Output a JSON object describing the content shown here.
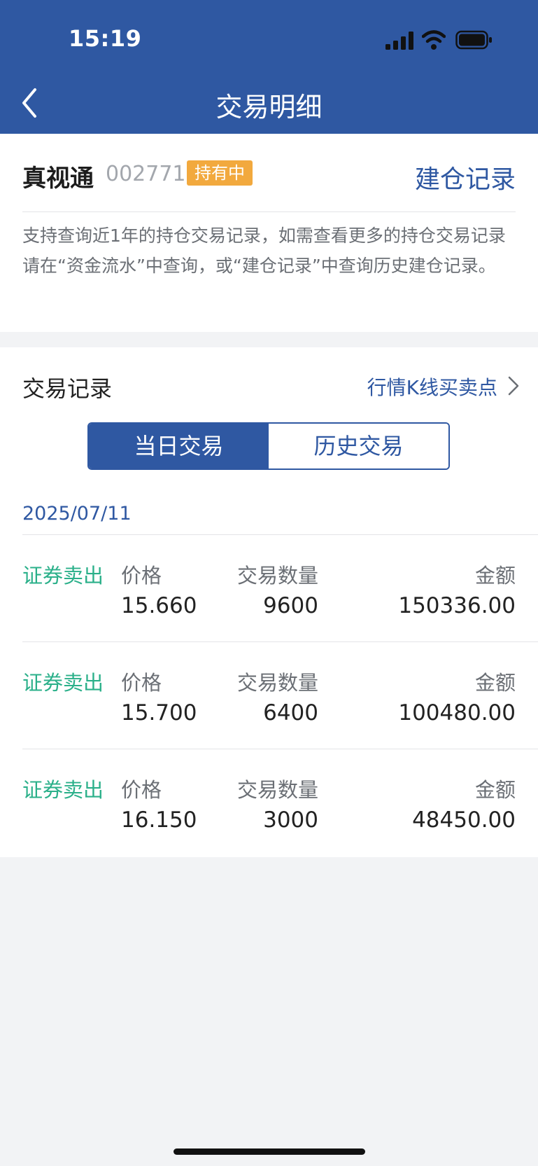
{
  "status_bar": {
    "time": "15:19"
  },
  "nav": {
    "title": "交易明细"
  },
  "stock": {
    "name": "真视通",
    "code": "002771",
    "badge": "持有中",
    "build_record_link": "建仓记录",
    "notice": "支持查询近1年的持仓交易记录，如需查看更多的持仓交易记录请在“资金流水”中查询，或“建仓记录”中查询历史建仓记录。"
  },
  "records": {
    "title": "交易记录",
    "kline_link": "行情K线买卖点",
    "tabs": [
      "当日交易",
      "历史交易"
    ],
    "active_tab": 0,
    "date": "2025/07/11",
    "labels": {
      "price": "价格",
      "quantity": "交易数量",
      "amount": "金额"
    },
    "trades": [
      {
        "type": "证券卖出",
        "price": "15.660",
        "quantity": "9600",
        "amount": "150336.00"
      },
      {
        "type": "证券卖出",
        "price": "15.700",
        "quantity": "6400",
        "amount": "100480.00"
      },
      {
        "type": "证券卖出",
        "price": "16.150",
        "quantity": "3000",
        "amount": "48450.00"
      }
    ]
  },
  "colors": {
    "brand_blue": "#2f58a2",
    "sell_green": "#2bb08a",
    "badge_orange": "#f2a93e",
    "page_bg": "#f2f3f5"
  },
  "icons": [
    "back-chevron-icon",
    "chevron-right-icon",
    "signal-icon",
    "wifi-icon",
    "battery-icon"
  ]
}
